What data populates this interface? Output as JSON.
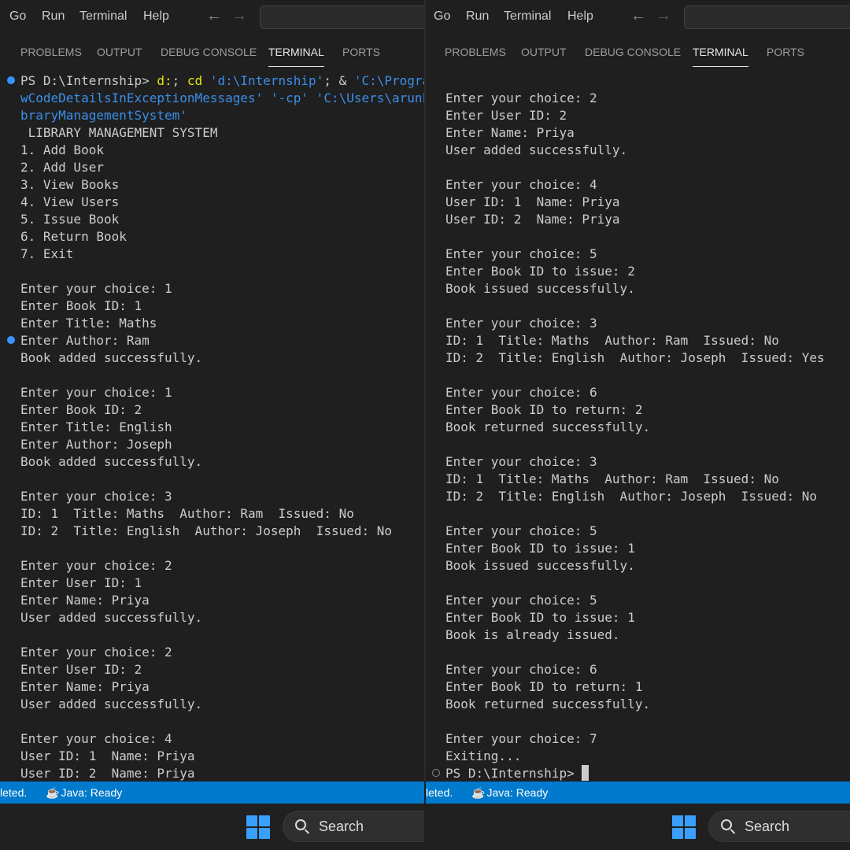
{
  "menu": [
    "Go",
    "Run",
    "Terminal",
    "Help"
  ],
  "tabs": [
    "PROBLEMS",
    "OUTPUT",
    "DEBUG CONSOLE",
    "TERMINAL",
    "PORTS"
  ],
  "left_terminal": {
    "prompt": "PS D:\\Internship> ",
    "cmd1": "d:",
    "sep1": "; ",
    "cmd2": "cd",
    "arg1": "'d:\\Internship'",
    "sep2": "; & ",
    "arg2": "'C:\\Program",
    "line2": "wCodeDetailsInExceptionMessages' '-cp' 'C:\\Users\\arunk\\Ap",
    "line3": "braryManagementSystem'",
    "output": " LIBRARY MANAGEMENT SYSTEM\n1. Add Book\n2. Add User\n3. View Books\n4. View Users\n5. Issue Book\n6. Return Book\n7. Exit\n\nEnter your choice: 1\nEnter Book ID: 1\nEnter Title: Maths\nEnter Author: Ram\nBook added successfully.\n\nEnter your choice: 1\nEnter Book ID: 2\nEnter Title: English\nEnter Author: Joseph\nBook added successfully.\n\nEnter your choice: 3\nID: 1  Title: Maths  Author: Ram  Issued: No\nID: 2  Title: English  Author: Joseph  Issued: No\n\nEnter your choice: 2\nEnter User ID: 1\nEnter Name: Priya\nUser added successfully.\n\nEnter your choice: 2\nEnter User ID: 2\nEnter Name: Priya\nUser added successfully.\n\nEnter your choice: 4\nUser ID: 1  Name: Priya\nUser ID: 2  Name: Priya"
  },
  "right_terminal": {
    "output": "Enter your choice: 2\nEnter User ID: 2\nEnter Name: Priya\nUser added successfully.\n\nEnter your choice: 4\nUser ID: 1  Name: Priya\nUser ID: 2  Name: Priya\n\nEnter your choice: 5\nEnter Book ID to issue: 2\nBook issued successfully.\n\nEnter your choice: 3\nID: 1  Title: Maths  Author: Ram  Issued: No\nID: 2  Title: English  Author: Joseph  Issued: Yes\n\nEnter your choice: 6\nEnter Book ID to return: 2\nBook returned successfully.\n\nEnter your choice: 3\nID: 1  Title: Maths  Author: Ram  Issued: No\nID: 2  Title: English  Author: Joseph  Issued: No\n\nEnter your choice: 5\nEnter Book ID to issue: 1\nBook issued successfully.\n\nEnter your choice: 5\nEnter Book ID to issue: 1\nBook is already issued.\n\nEnter your choice: 6\nEnter Book ID to return: 1\nBook returned successfully.\n\nEnter your choice: 7\nExiting...",
    "final_prompt": "PS D:\\Internship> "
  },
  "status": {
    "left_text": "leted.",
    "java": "Java: Ready"
  },
  "taskbar": {
    "search_label": "Search"
  },
  "colors": {
    "status_bar": "#007acc",
    "background": "#1f1f1f",
    "command_yellow": "#e5e510",
    "string_blue": "#3b8eea"
  }
}
